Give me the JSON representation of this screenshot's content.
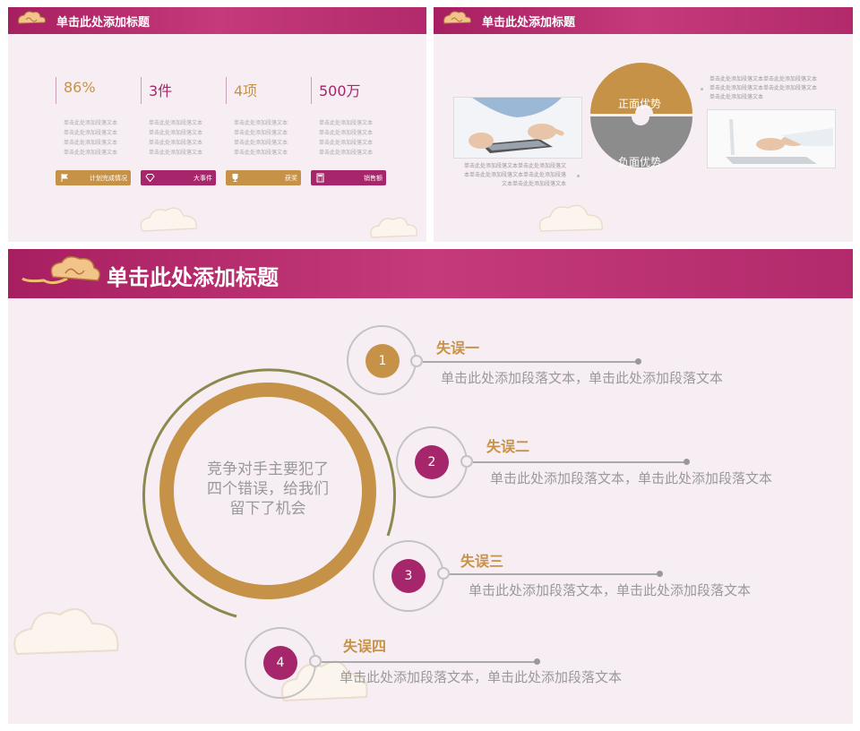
{
  "colors": {
    "brand_plum": "#a5266a",
    "brand_gold": "#c69247",
    "background": "#f7eef4"
  },
  "slide1": {
    "title": "单击此处添加标题",
    "stats": [
      {
        "value": "86%",
        "text": "单击此处添加段落文本\n单击此处添加段落文本\n单击此处添加段落文本\n单击此处添加段落文本",
        "tag": "计划完成情况",
        "icon": "flag-icon"
      },
      {
        "value": "3件",
        "text": "单击此处添加段落文本\n单击此处添加段落文本\n单击此处添加段落文本\n单击此处添加段落文本",
        "tag": "大事件",
        "icon": "diamond-icon"
      },
      {
        "value": "4项",
        "text": "单击此处添加段落文本\n单击此处添加段落文本\n单击此处添加段落文本\n单击此处添加段落文本",
        "tag": "获奖",
        "icon": "trophy-icon"
      },
      {
        "value": "500万",
        "text": "单击此处添加段落文本\n单击此处添加段落文本\n单击此处添加段落文本\n单击此处添加段落文本",
        "tag": "销售额",
        "icon": "calculator-icon"
      }
    ]
  },
  "slide2": {
    "title": "单击此处添加标题",
    "positive": "正面优势",
    "negative": "负面优势",
    "left_text": "单击此处添加段落文本单击此处添加段落文\n本单击此处添加段落文本单击此处添加段落\n文本单击此处添加段落文本",
    "right_text": "单击此处添加段落文本单击此处添加段落文本\n单击此处添加段落文本单击此处添加段落文本\n单击此处添加段落文本"
  },
  "slide3": {
    "title": "单击此处添加标题",
    "center_text": "竞争对手主要犯了\n四个错误，给我们\n留下了机会",
    "errors": [
      {
        "num": "1",
        "title": "失误一",
        "desc": "单击此处添加段落文本，单击此处添加段落文本"
      },
      {
        "num": "2",
        "title": "失误二",
        "desc": "单击此处添加段落文本，单击此处添加段落文本"
      },
      {
        "num": "3",
        "title": "失误三",
        "desc": "单击此处添加段落文本，单击此处添加段落文本"
      },
      {
        "num": "4",
        "title": "失误四",
        "desc": "单击此处添加段落文本，单击此处添加段落文本"
      }
    ]
  }
}
